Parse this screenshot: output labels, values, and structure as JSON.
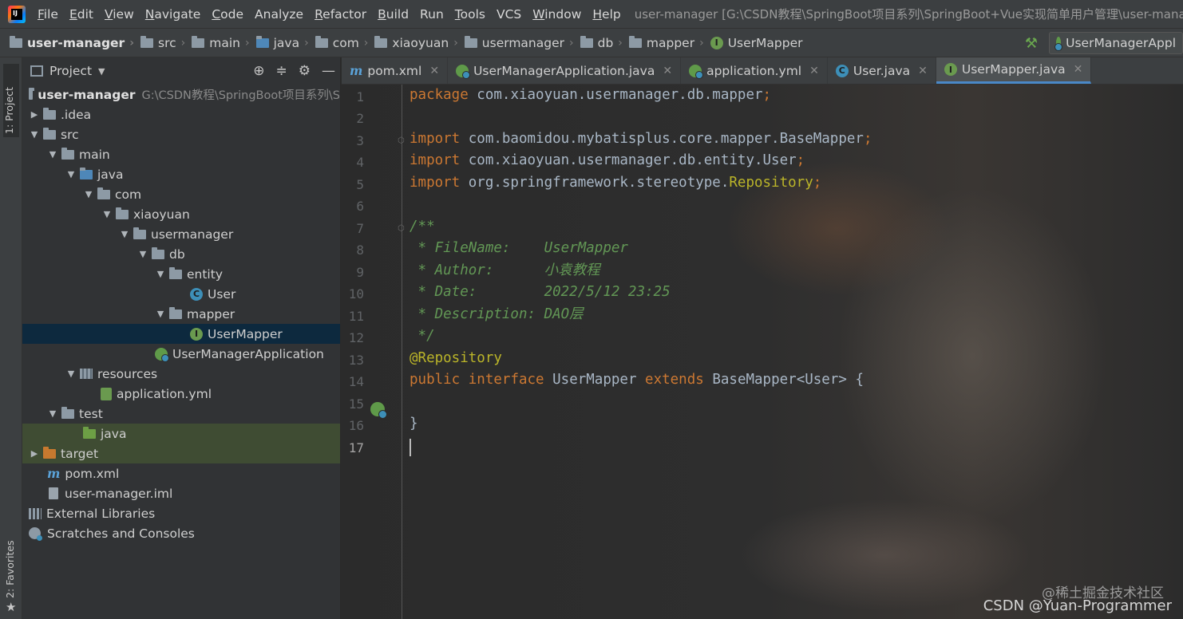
{
  "menu": {
    "items": [
      {
        "underline": "F",
        "rest": "ile"
      },
      {
        "underline": "E",
        "rest": "dit"
      },
      {
        "underline": "V",
        "rest": "iew"
      },
      {
        "underline": "N",
        "rest": "avigate"
      },
      {
        "underline": "C",
        "rest": "ode"
      },
      {
        "underline": "",
        "rest": "Analyze"
      },
      {
        "underline": "R",
        "rest": "efactor"
      },
      {
        "underline": "B",
        "rest": "uild"
      },
      {
        "underline": "",
        "rest": "Run"
      },
      {
        "underline": "T",
        "rest": "ools"
      },
      {
        "underline": "",
        "rest": "VCS"
      },
      {
        "underline": "W",
        "rest": "indow"
      },
      {
        "underline": "H",
        "rest": "elp"
      }
    ],
    "window_title": "user-manager [G:\\CSDN教程\\SpringBoot项目系列\\SpringBoot+Vue实现简单用户管理\\user-manag"
  },
  "breadcrumb": {
    "items": [
      "user-manager",
      "src",
      "main",
      "java",
      "com",
      "xiaoyuan",
      "usermanager",
      "db",
      "mapper",
      "UserMapper"
    ],
    "run_config": "UserManagerAppl"
  },
  "left_strip": {
    "project_label": "1: Project",
    "favorites_label": "2: Favorites"
  },
  "project_panel": {
    "title": "Project",
    "root_path": "G:\\CSDN教程\\SpringBoot项目系列\\S",
    "tree": [
      {
        "label": "user-manager",
        "depth": 0
      },
      {
        "label": ".idea",
        "depth": 1
      },
      {
        "label": "src",
        "depth": 1
      },
      {
        "label": "main",
        "depth": 2
      },
      {
        "label": "java",
        "depth": 3
      },
      {
        "label": "com",
        "depth": 4
      },
      {
        "label": "xiaoyuan",
        "depth": 5
      },
      {
        "label": "usermanager",
        "depth": 6
      },
      {
        "label": "db",
        "depth": 7
      },
      {
        "label": "entity",
        "depth": 8
      },
      {
        "label": "User",
        "depth": 9
      },
      {
        "label": "mapper",
        "depth": 8
      },
      {
        "label": "UserMapper",
        "depth": 9
      },
      {
        "label": "UserManagerApplication",
        "depth": 7
      },
      {
        "label": "resources",
        "depth": 3
      },
      {
        "label": "application.yml",
        "depth": 4
      },
      {
        "label": "test",
        "depth": 2
      },
      {
        "label": "java",
        "depth": 3
      },
      {
        "label": "target",
        "depth": 1
      },
      {
        "label": "pom.xml",
        "depth": 1
      },
      {
        "label": "user-manager.iml",
        "depth": 1
      },
      {
        "label": "External Libraries",
        "depth": 0
      },
      {
        "label": "Scratches and Consoles",
        "depth": 0
      }
    ]
  },
  "tabs": [
    {
      "label": "pom.xml",
      "icon": "maven-icon"
    },
    {
      "label": "UserManagerApplication.java",
      "icon": "spring-class-icon"
    },
    {
      "label": "application.yml",
      "icon": "yaml-icon"
    },
    {
      "label": "User.java",
      "icon": "class-icon"
    },
    {
      "label": "UserMapper.java",
      "icon": "interface-icon",
      "active": true
    }
  ],
  "editor": {
    "line_numbers": [
      "1",
      "2",
      "3",
      "4",
      "5",
      "6",
      "7",
      "8",
      "9",
      "10",
      "11",
      "12",
      "13",
      "14",
      "15",
      "16",
      "17"
    ],
    "current_line": "17",
    "code": {
      "l1_kw": "package",
      "l1_rest": " com.xiaoyuan.usermanager.db.mapper",
      "l1_semi": ";",
      "l3_kw": "import",
      "l3_rest": " com.baomidou.mybatisplus.core.mapper.BaseMapper",
      "l3_semi": ";",
      "l4_kw": "import",
      "l4_rest": " com.xiaoyuan.usermanager.db.entity.User",
      "l4_semi": ";",
      "l5_kw": "import",
      "l5_rest": " org.springframework.stereotype.",
      "l5_ann": "Repository",
      "l5_semi": ";",
      "l7": "/**",
      "l8": " * FileName:    UserMapper",
      "l9": " * Author:      小袁教程",
      "l10": " * Date:        2022/5/12 23:25",
      "l11": " * Description: DAO层",
      "l12": " */",
      "l13": "@Repository",
      "l14_kw1": "public",
      "l14_kw2": "interface",
      "l14_name": " UserMapper ",
      "l14_kw3": "extends",
      "l14_rest": " BaseMapper<User> {",
      "l16": "}"
    }
  },
  "watermarks": {
    "juejin": "@稀土掘金技术社区",
    "csdn": "CSDN @Yuan-Programmer"
  },
  "colors": {
    "keyword": "#cc7832",
    "annotation": "#bbb529",
    "comment": "#629755",
    "selection": "#0d293e",
    "active_tab_underline": "#4a88c7"
  }
}
